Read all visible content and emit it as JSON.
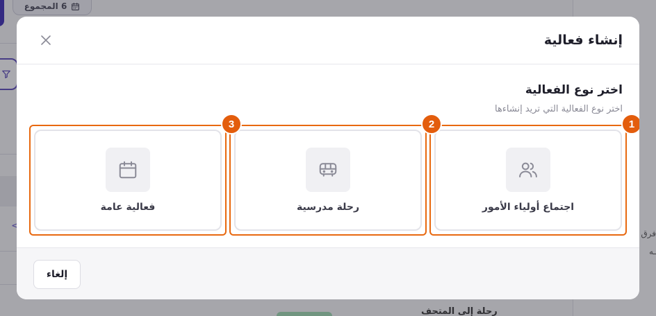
{
  "background": {
    "badge_label": "6 المجموع",
    "right_text_1": "فرق",
    "right_text_2": "ـه",
    "chevron": "<",
    "bottom_item": "رحلة إلى المتحف"
  },
  "modal": {
    "title": "إنشاء فعالية",
    "section_title": "اختر نوع الفعالية",
    "section_subtitle": "اختر نوع الفعالية التي تريد إنشاءها",
    "cards": [
      {
        "number": "1",
        "label": "اجتماع أولياء الأمور",
        "icon": "users-icon"
      },
      {
        "number": "2",
        "label": "رحلة مدرسية",
        "icon": "bus-icon"
      },
      {
        "number": "3",
        "label": "فعالية عامة",
        "icon": "calendar-icon"
      }
    ],
    "cancel_label": "إلغاء"
  },
  "colors": {
    "highlight": "#e8680f",
    "badge": "#e35d0d",
    "accent": "#3c2db4"
  }
}
